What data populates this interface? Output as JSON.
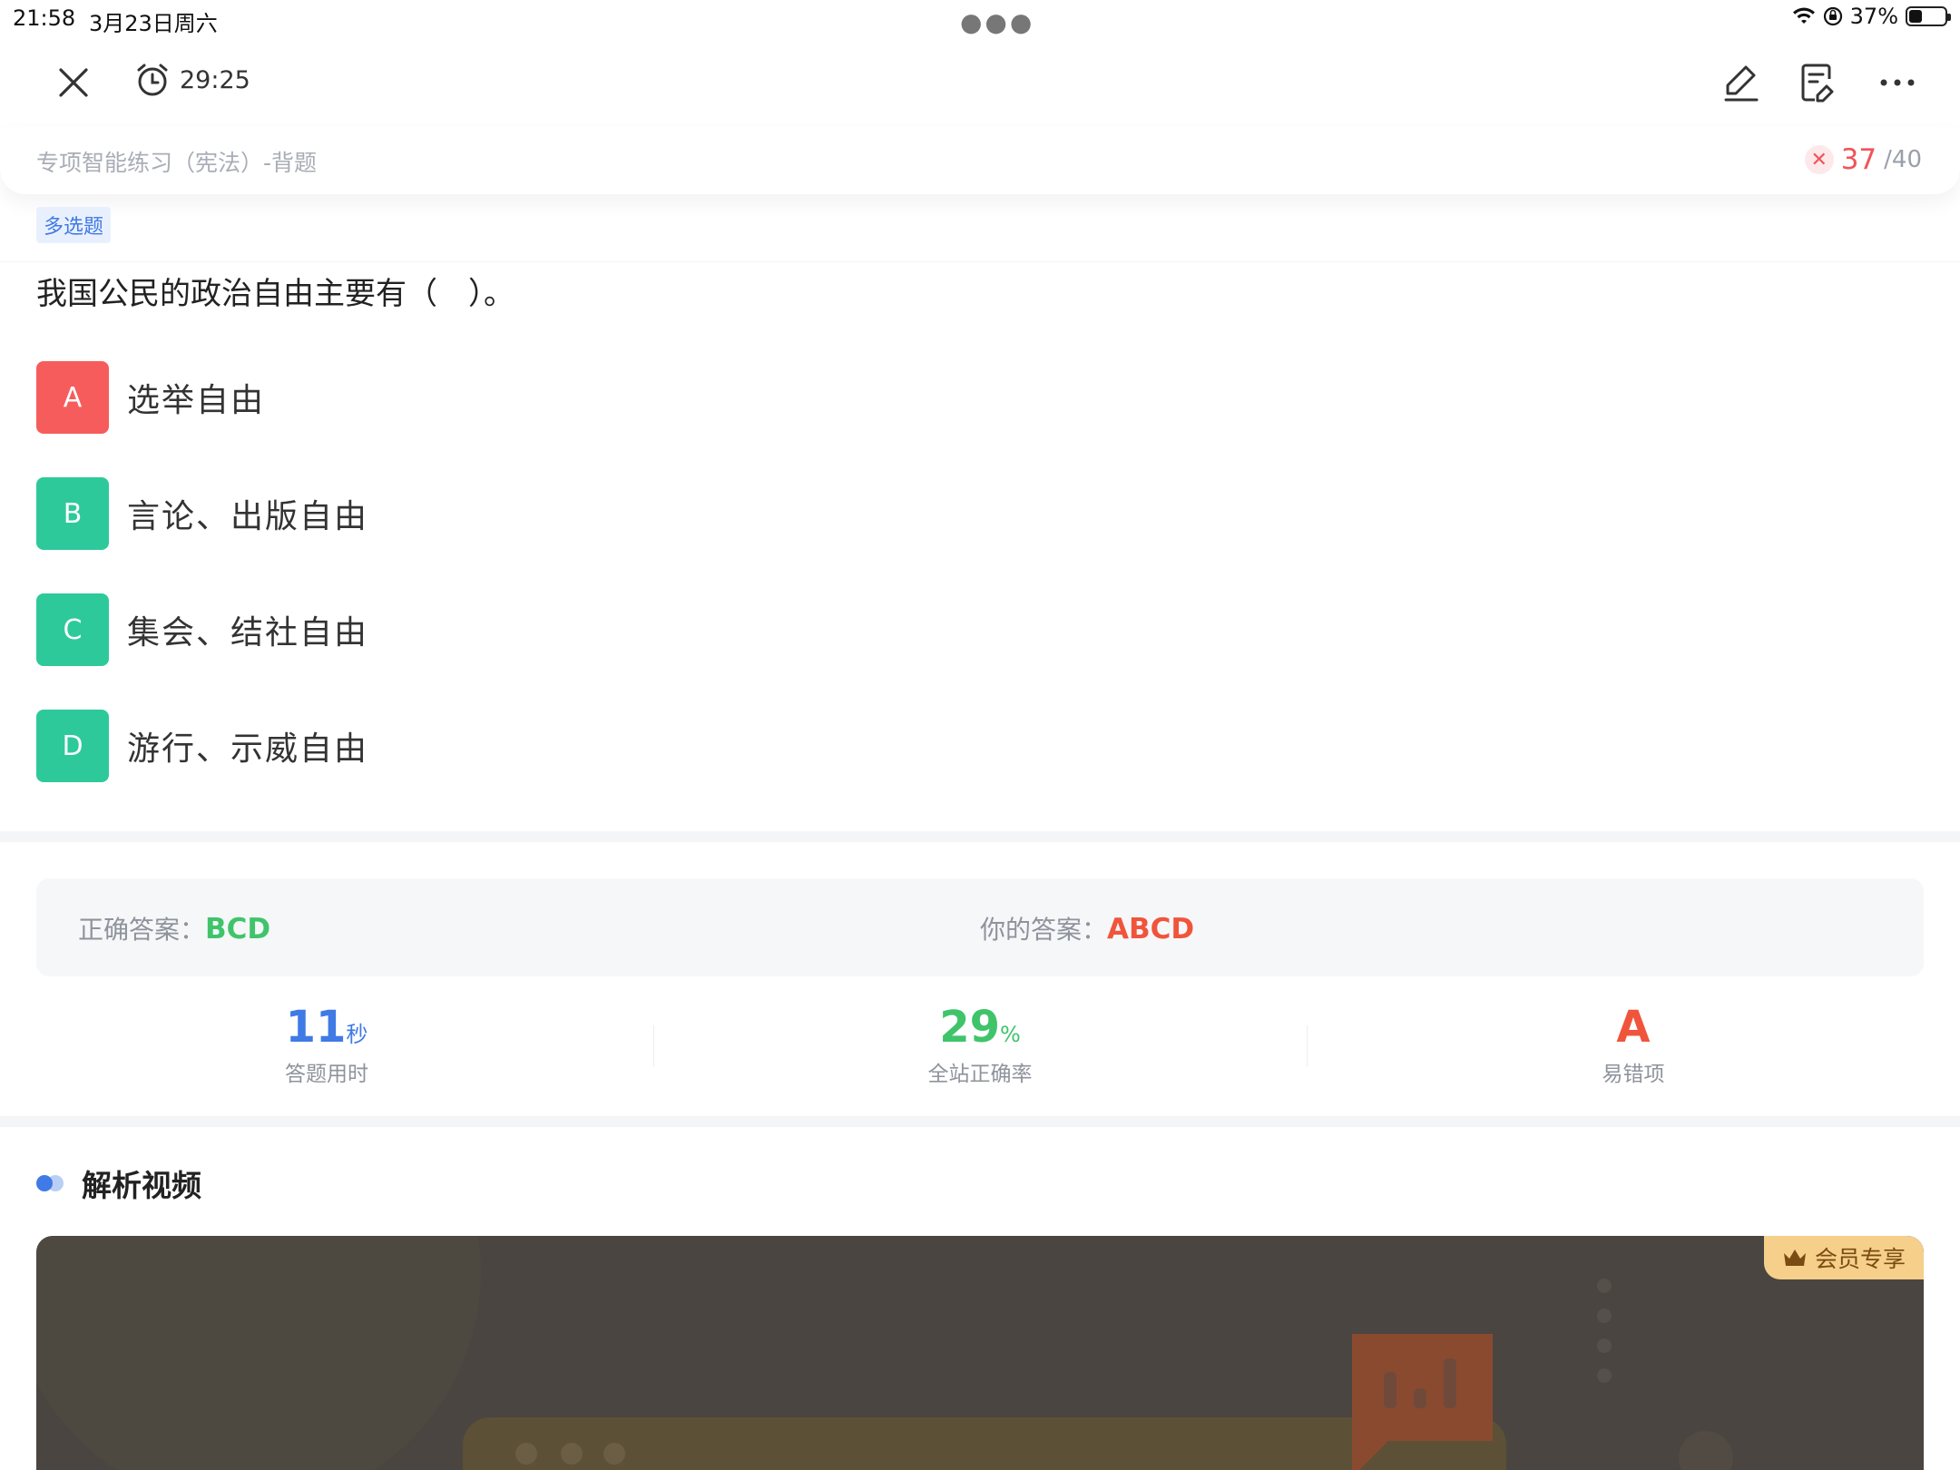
{
  "status_bar": {
    "time": "21:58",
    "date": "3月23日周六",
    "battery": "37%",
    "battery_level": 0.37
  },
  "toolbar": {
    "timer": "29:25"
  },
  "header": {
    "practice_title": "专项智能练习（宪法）-背题",
    "progress_current": "37",
    "progress_total": "/40"
  },
  "question": {
    "type": "多选题",
    "text": "我国公民的政治自由主要有（　）。",
    "options": [
      {
        "letter": "A",
        "text": "选举自由",
        "state": "wrong"
      },
      {
        "letter": "B",
        "text": "言论、出版自由",
        "state": "correct"
      },
      {
        "letter": "C",
        "text": "集会、结社自由",
        "state": "correct"
      },
      {
        "letter": "D",
        "text": "游行、示威自由",
        "state": "correct"
      }
    ]
  },
  "answer": {
    "correct_label": "正确答案：",
    "correct_value": "BCD",
    "yours_label": "你的答案：",
    "yours_value": "ABCD"
  },
  "stats": {
    "time_value": "11",
    "time_unit": "秒",
    "time_label": "答题用时",
    "rate_value": "29",
    "rate_unit": "%",
    "rate_label": "全站正确率",
    "error_value": "A",
    "error_label": "易错项"
  },
  "video": {
    "section_title": "解析视频",
    "vip_badge": "会员专享"
  },
  "colors": {
    "wrong": "#f75c5c",
    "correct": "#2ec99a",
    "accent_blue": "#3f7ae6",
    "accent_green": "#3fc46a",
    "accent_red": "#f0553b"
  }
}
